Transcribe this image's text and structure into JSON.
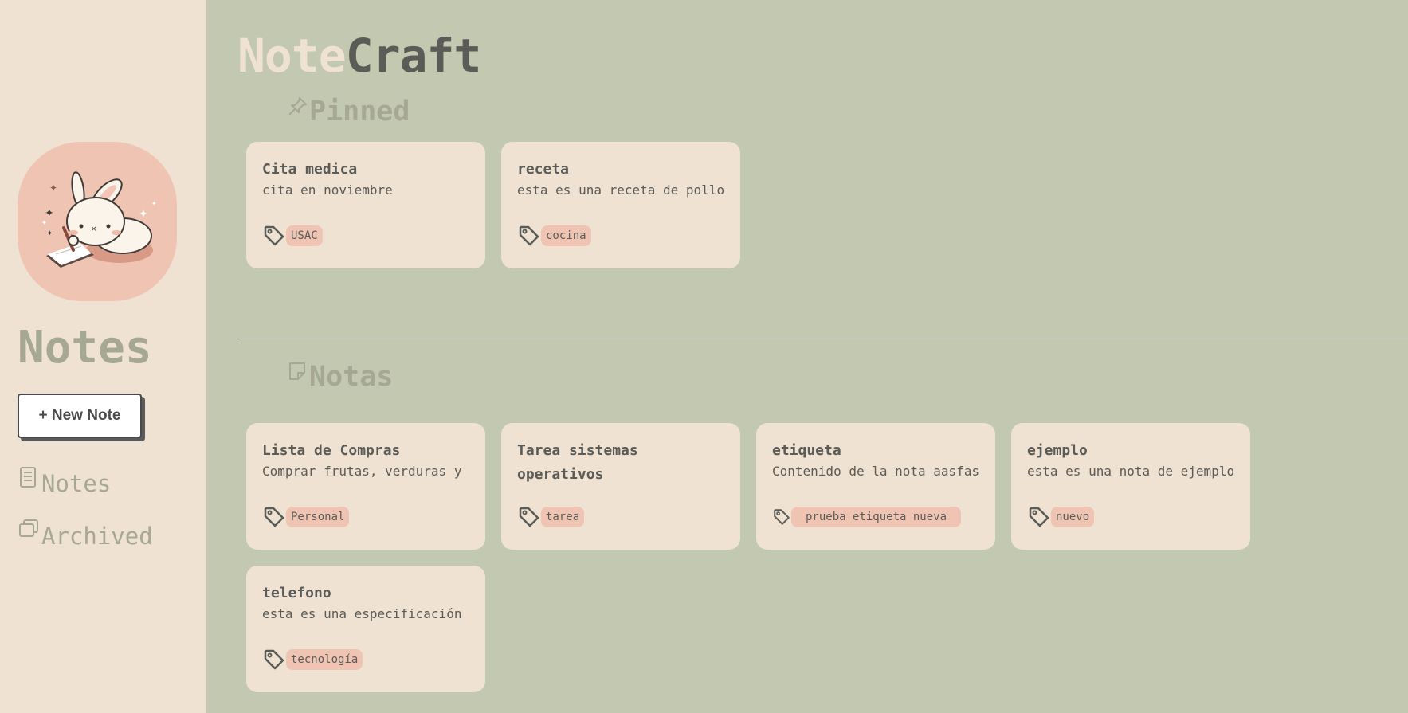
{
  "brand": {
    "part1": "Note",
    "part2": "Craft"
  },
  "sidebar": {
    "title": "Notes",
    "new_note_label": "+ New Note",
    "nav": [
      {
        "label": "Notes",
        "icon": "document-icon"
      },
      {
        "label": "Archived",
        "icon": "archive-icon"
      }
    ]
  },
  "sections": {
    "pinned": {
      "title": "Pinned",
      "icon": "pin-icon"
    },
    "notes": {
      "title": "Notas",
      "icon": "sticky-note-icon"
    }
  },
  "pinned_notes": [
    {
      "title": "Cita medica",
      "content": "cita en noviembre",
      "tag": "USAC"
    },
    {
      "title": "receta",
      "content": "esta es una receta de pollo",
      "tag": "cocina"
    }
  ],
  "notes": [
    {
      "title": "Lista de Compras",
      "content": "Comprar frutas, verduras y",
      "tag": "Personal"
    },
    {
      "title": "Tarea sistemas operativos",
      "content": "",
      "tag": "tarea"
    },
    {
      "title": "etiqueta",
      "content": "Contenido de la nota aasfas",
      "tag": "prueba etiqueta nueva"
    },
    {
      "title": "ejemplo",
      "content": "esta es una nota de ejemplo",
      "tag": "nuevo"
    },
    {
      "title": "telefono",
      "content": "esta es una especificación",
      "tag": "tecnología"
    }
  ],
  "colors": {
    "background": "#c3c8b0",
    "sidebar": "#efe2d3",
    "card": "#efe2d3",
    "tag": "#f0c4b3",
    "text": "#5b5b57",
    "muted": "#a7a894"
  }
}
